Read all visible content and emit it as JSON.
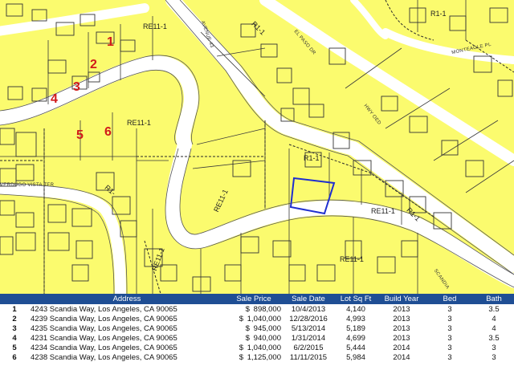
{
  "map": {
    "zone_labels": [
      "RE11-1",
      "RE11-1",
      "RE11-1",
      "RE11-1",
      "RE11-1",
      "RE11-1",
      "R1-1",
      "R1-1",
      "R1-1",
      "R1-1",
      "R1-"
    ],
    "street_labels": [
      "AVENUE 43",
      "EL PASO DR",
      "HWY OED",
      "MONTEAGLE PL",
      "VERDUGO VISTA TER",
      "SCANDIA"
    ],
    "lot_numbers": [
      "1",
      "2",
      "3",
      "4",
      "5",
      "6"
    ],
    "colors": {
      "parcel_fill": "#fbfb6e",
      "street_fill": "#ffffff",
      "outline": "#3a3a3a",
      "highlight": "#1f2fcf",
      "lot_number": "#d11a1a"
    }
  },
  "table": {
    "headers": [
      "",
      "Address",
      "Sale Price",
      "Sale Date",
      "Lot Sq Ft",
      "Build Year",
      "Bed",
      "Bath"
    ],
    "rows": [
      {
        "num": "1",
        "address": "4243 Scandia Way, Los Angeles, CA 90065",
        "price": "898,000",
        "date": "10/4/2013",
        "lot": "4,140",
        "year": "2013",
        "bed": "3",
        "bath": "3.5"
      },
      {
        "num": "2",
        "address": "4239 Scandia Way, Los Angeles, CA 90065",
        "price": "1,040,000",
        "date": "12/28/2016",
        "lot": "4,993",
        "year": "2013",
        "bed": "3",
        "bath": "4"
      },
      {
        "num": "3",
        "address": "4235 Scandia Way, Los Angeles, CA 90065",
        "price": "945,000",
        "date": "5/13/2014",
        "lot": "5,189",
        "year": "2013",
        "bed": "3",
        "bath": "4"
      },
      {
        "num": "4",
        "address": "4231 Scandia Way, Los Angeles, CA 90065",
        "price": "940,000",
        "date": "1/31/2014",
        "lot": "4,699",
        "year": "2013",
        "bed": "3",
        "bath": "3.5"
      },
      {
        "num": "5",
        "address": "4234 Scandia Way, Los Angeles, CA 90065",
        "price": "1,040,000",
        "date": "6/2/2015",
        "lot": "5,444",
        "year": "2014",
        "bed": "3",
        "bath": "3"
      },
      {
        "num": "6",
        "address": "4238 Scandia Way, Los Angeles, CA 90065",
        "price": "1,125,000",
        "date": "11/11/2015",
        "lot": "5,984",
        "year": "2014",
        "bed": "3",
        "bath": "3"
      }
    ],
    "currency_symbol": "$",
    "colors": {
      "header_bg": "#1f4e94",
      "header_text": "#ffffff"
    }
  }
}
